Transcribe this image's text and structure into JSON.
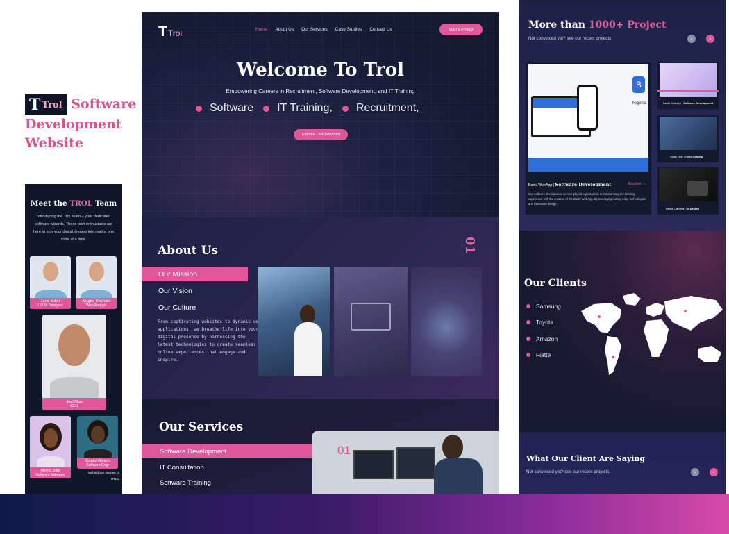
{
  "showcase": {
    "logo": {
      "t": "T",
      "rol": "Trol"
    },
    "title": "Software Development Website"
  },
  "team": {
    "heading_pre": "Meet the",
    "heading_accent": "TROL",
    "heading_post": "Team",
    "intro": "Introducing the Trol Team – your dedicated software wizards. These tech enthusiasts are here to turn your digital dreams into reality, one code at a time.",
    "members": [
      {
        "name": "Jane Miller",
        "role": "UI/UX Designer"
      },
      {
        "name": "Alogba Rochdel",
        "role": "Web Analyst"
      },
      {
        "name": "Joel Blue",
        "role": "CEO"
      },
      {
        "name": "Merry Jolie",
        "role": "Software Manager"
      },
      {
        "name": "Daniel Rivers",
        "role": "Software Engr"
      }
    ],
    "behind": "Behind the scenes of TROL"
  },
  "nav": {
    "logo_t": "T",
    "logo_rol": "Trol",
    "items": [
      "Home",
      "About Us",
      "Our Services",
      "Case Studies",
      "Contact Us"
    ],
    "cta": "Start a Project"
  },
  "hero": {
    "title": "Welcome To Trol",
    "subtitle": "Empowering Careers in Recruitment, Software Development, and IT Training",
    "ticker": [
      "Software",
      "IT Training,",
      "Recruitment,"
    ],
    "cta": "Explore Our Services"
  },
  "about": {
    "title": "About Us",
    "number": "01",
    "tabs": [
      "Our Mission",
      "Our Vision",
      "Our  Culture"
    ],
    "body": "From captivating websites to dynamic web applications, we breathe life into your digital presence by harnessing the latest  technologies to create seamless online experiences that engage and inspire."
  },
  "services": {
    "title": "Our Services",
    "tabs": [
      "Software Development",
      "IT Consultation",
      "Software Training"
    ],
    "number": "01"
  },
  "projects": {
    "title_pre": "More than",
    "title_accent": "1000+ Project",
    "subtitle": "Not convinced yet? see our recent projects",
    "featured": {
      "client": "Banki WebApp",
      "category": "Software Development",
      "link": "Explore",
      "body": "Our software development service played a pivotal role in transforming the banking experience with the creation of the Banki WebApp. By leveraging cutting-edge technologies and innovative design."
    },
    "side": [
      {
        "client": "Banki Webapp",
        "category": "Software Development"
      },
      {
        "client": "Scale Hub",
        "category": "Tech Training"
      },
      {
        "client": "Rewls Camera",
        "category": "UI Design"
      }
    ],
    "mockup_label": "Nigeria"
  },
  "clients": {
    "title": "Our Clients",
    "items": [
      "Samsung",
      "Toyota",
      "Amazon",
      "Fiatte"
    ]
  },
  "testimonials": {
    "title": "What Our Client Are Saying",
    "subtitle": "Not convinced yet? see our recent projects"
  },
  "colors": {
    "accent": "#e0579a",
    "dark": "#161b33",
    "band_end": "#d64aa8"
  }
}
